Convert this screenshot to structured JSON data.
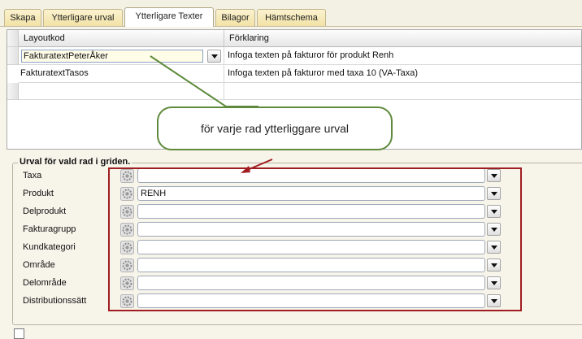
{
  "tabs": [
    "Skapa",
    "Ytterligare urval",
    "Ytterligare Texter",
    "Bilagor",
    "Hämtschema"
  ],
  "grid": {
    "columns": [
      "Layoutkod",
      "Förklaring"
    ],
    "rows": [
      {
        "layoutkod": "FakturatextPeterÅker",
        "forklaring": "Infoga texten på fakturor för produkt Renh"
      },
      {
        "layoutkod": "FakturatextTasos",
        "forklaring": "Infoga texten på fakturor med taxa 10 (VA-Taxa)"
      }
    ]
  },
  "callout": "för varje rad ytterliggare urval",
  "filter_group": {
    "title": "Urval för vald rad i griden.",
    "fields": [
      {
        "label": "Taxa",
        "value": ""
      },
      {
        "label": "Produkt",
        "value": "RENH"
      },
      {
        "label": "Delprodukt",
        "value": ""
      },
      {
        "label": "Fakturagrupp",
        "value": ""
      },
      {
        "label": "Kundkategori",
        "value": ""
      },
      {
        "label": "Område",
        "value": ""
      },
      {
        "label": "Delområde",
        "value": ""
      },
      {
        "label": "Distributionssätt",
        "value": ""
      }
    ]
  },
  "colors": {
    "accent_red": "#a01e22",
    "callout_border": "#5f8a3c"
  }
}
